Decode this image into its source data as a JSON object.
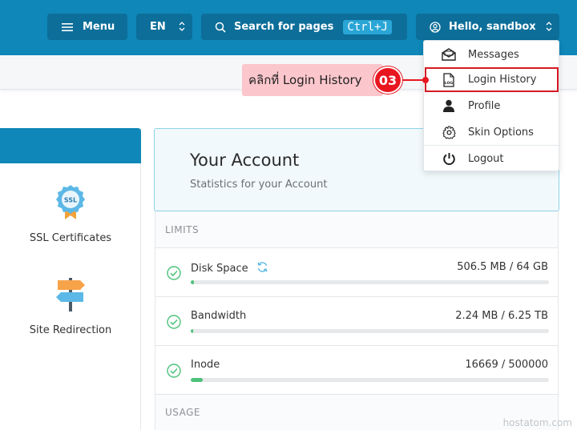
{
  "topbar": {
    "menu_label": "Menu",
    "lang_label": "EN",
    "search_label": "Search for pages",
    "search_shortcut": "Ctrl+J",
    "user_label": "Hello, sandbox",
    "icons": [
      "hamburger-icon",
      "search-icon",
      "user-circle-icon",
      "updown-chevron-icon"
    ]
  },
  "callout": {
    "text": "คลิกที่ Login History",
    "step": "03",
    "color": "#e8161f"
  },
  "dropdown": {
    "items": [
      {
        "label": "Messages",
        "icon": "envelope-icon"
      },
      {
        "label": "Login History",
        "icon": "log-file-icon",
        "highlighted": true
      },
      {
        "label": "Profile",
        "icon": "person-icon"
      },
      {
        "label": "Skin Options",
        "icon": "gear-icon"
      },
      {
        "label": "Logout",
        "icon": "power-icon"
      }
    ]
  },
  "left_panel": {
    "items": [
      {
        "label": "SSL Certificates",
        "icon": "ssl-badge-icon",
        "icon_text": "SSL"
      },
      {
        "label": "Site Redirection",
        "icon": "signpost-icon"
      }
    ]
  },
  "account": {
    "title": "Your Account",
    "subtitle": "Statistics for your Account"
  },
  "limits": {
    "heading": "LIMITS",
    "rows": [
      {
        "name": "Disk Space",
        "value": "506.5 MB / 64 GB",
        "fraction": 0.008,
        "refresh_icon": true
      },
      {
        "name": "Bandwidth",
        "value": "2.24 MB / 6.25 TB",
        "fraction": 0.001
      },
      {
        "name": "Inode",
        "value": "16669 / 500000",
        "fraction": 0.033
      }
    ],
    "usage_heading": "USAGE"
  },
  "watermark": "hostatom.com",
  "colors": {
    "topbar": "#0f87b8",
    "button": "#0c6e99",
    "accent_green": "#4cc27a",
    "highlight_red": "#d51a23",
    "callout_bg": "#fbc6cc"
  }
}
